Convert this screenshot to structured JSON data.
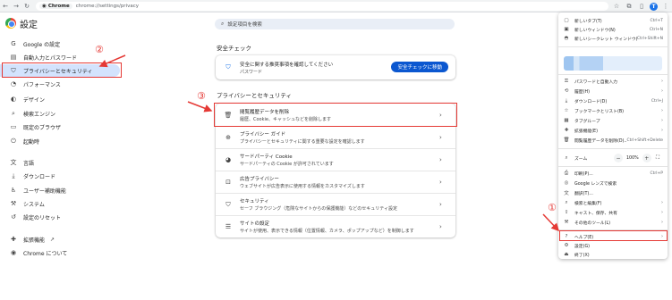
{
  "browser": {
    "chip_label": "Chrome",
    "url": "chrome://settings/privacy",
    "avatar_letter": "T"
  },
  "header": {
    "title": "設定",
    "search_placeholder": "設定項目を検索"
  },
  "sidebar": {
    "items": [
      {
        "label": "Google の設定",
        "icon": "google-icon"
      },
      {
        "label": "自動入力とパスワード",
        "icon": "clipboard-icon"
      },
      {
        "label": "プライバシーとセキュリティ",
        "icon": "shield-icon"
      },
      {
        "label": "パフォーマンス",
        "icon": "speedometer-icon"
      },
      {
        "label": "デザイン",
        "icon": "palette-icon"
      },
      {
        "label": "検索エンジン",
        "icon": "search-icon"
      },
      {
        "label": "既定のブラウザ",
        "icon": "browser-icon"
      },
      {
        "label": "起動時",
        "icon": "power-icon"
      },
      {
        "label": "言語",
        "icon": "language-icon"
      },
      {
        "label": "ダウンロード",
        "icon": "download-icon"
      },
      {
        "label": "ユーザー補助機能",
        "icon": "accessibility-icon"
      },
      {
        "label": "システム",
        "icon": "wrench-icon"
      },
      {
        "label": "設定のリセット",
        "icon": "reset-icon"
      },
      {
        "label": "拡張機能",
        "icon": "puzzle-icon"
      },
      {
        "label": "Chrome について",
        "icon": "chrome-icon"
      }
    ]
  },
  "safety_check": {
    "title": "安全チェック",
    "line1": "安全に関する推奨事項を確認してください",
    "line2": "パスワード",
    "button": "安全チェックに移動"
  },
  "privacy": {
    "title": "プライバシーとセキュリティ",
    "rows": [
      {
        "title": "閲覧履歴データを削除",
        "subtitle": "履歴、Cookie、キャッシュなどを削除します",
        "icon": "trash-icon"
      },
      {
        "title": "プライバシー ガイド",
        "subtitle": "プライバシーとセキュリティに関する重要な設定を確認します",
        "icon": "privacy-guide-icon"
      },
      {
        "title": "サードパーティ Cookie",
        "subtitle": "サードパーティの Cookie が許可されています",
        "icon": "cookie-icon"
      },
      {
        "title": "広告プライバシー",
        "subtitle": "ウェブサイトが広告表示に使用する情報をカスタマイズします",
        "icon": "ad-privacy-icon"
      },
      {
        "title": "セキュリティ",
        "subtitle": "セーフ ブラウジング（危険なサイトからの保護機能）などのセキュリティ設定",
        "icon": "shield-icon"
      },
      {
        "title": "サイトの設定",
        "subtitle": "サイトが使用、表示できる情報（位置情報、カメラ、ポップアップなど）を制御します",
        "icon": "sliders-icon"
      }
    ]
  },
  "menu": {
    "group1": [
      {
        "label": "新しいタブ(T)",
        "shortcut": "Ctrl+T",
        "icon": "new-tab-icon"
      },
      {
        "label": "新しいウィンドウ(N)",
        "shortcut": "Ctrl+N",
        "icon": "new-window-icon"
      },
      {
        "label": "新しいシークレット ウィンドウ(I)",
        "shortcut": "Ctrl+Shift+N",
        "icon": "incognito-icon"
      }
    ],
    "group2": [
      {
        "label": "パスワードと自動入力",
        "icon": "key-icon"
      },
      {
        "label": "履歴(H)",
        "icon": "history-icon"
      },
      {
        "label": "ダウンロード(D)",
        "shortcut": "Ctrl+J",
        "icon": "download-icon"
      },
      {
        "label": "ブックマークとリスト(B)",
        "icon": "star-icon"
      },
      {
        "label": "タブグループ",
        "icon": "tab-group-icon"
      },
      {
        "label": "拡張機能(E)",
        "icon": "puzzle-icon"
      },
      {
        "label": "閲覧履歴データを削除(D)...",
        "shortcut": "Ctrl+Shift+Delete",
        "icon": "trash-icon"
      }
    ],
    "zoom": {
      "label": "ズーム",
      "minus": "−",
      "value": "100%",
      "plus": "+"
    },
    "group3": [
      {
        "label": "印刷(P)...",
        "shortcut": "Ctrl+P",
        "icon": "print-icon"
      },
      {
        "label": "Google レンズで検索",
        "icon": "lens-icon"
      },
      {
        "label": "翻訳(T)...",
        "icon": "translate-icon"
      },
      {
        "label": "検索と編集(F)",
        "icon": "find-icon"
      },
      {
        "label": "キャスト、保存、共有",
        "icon": "cast-icon"
      },
      {
        "label": "その他のツール(L)",
        "icon": "tools-icon"
      }
    ],
    "group4": [
      {
        "label": "ヘルプ(E)",
        "icon": "help-icon"
      },
      {
        "label": "設定(G)",
        "icon": "gear-icon"
      },
      {
        "label": "終了(X)",
        "icon": "exit-icon"
      }
    ]
  },
  "annotations": {
    "step1": "①",
    "step2": "②",
    "step3": "③",
    "color": "#e53935"
  }
}
